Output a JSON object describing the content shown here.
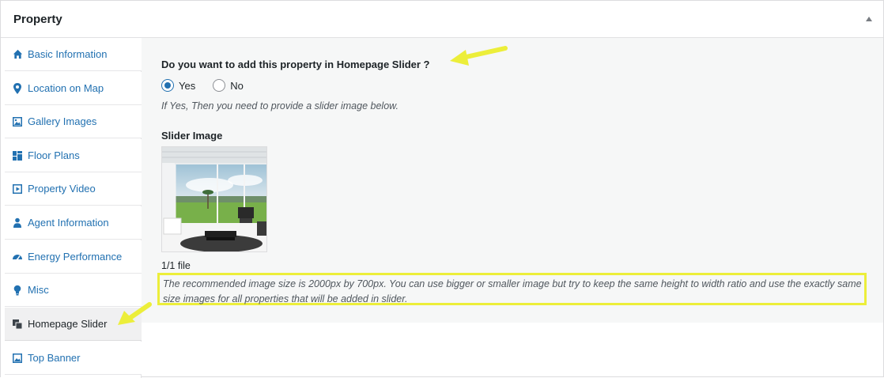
{
  "box": {
    "title": "Property",
    "toggle_icon": "triangle-up-icon"
  },
  "sidebar": {
    "items": [
      {
        "label": "Basic Information",
        "icon": "home-icon"
      },
      {
        "label": "Location on Map",
        "icon": "location-pin-icon"
      },
      {
        "label": "Gallery Images",
        "icon": "gallery-icon"
      },
      {
        "label": "Floor Plans",
        "icon": "floor-plans-icon"
      },
      {
        "label": "Property Video",
        "icon": "video-icon"
      },
      {
        "label": "Agent Information",
        "icon": "agent-icon"
      },
      {
        "label": "Energy Performance",
        "icon": "gauge-icon"
      },
      {
        "label": "Misc",
        "icon": "lightbulb-icon"
      },
      {
        "label": "Homepage Slider",
        "icon": "slides-icon",
        "active": true
      },
      {
        "label": "Top Banner",
        "icon": "banner-image-icon"
      }
    ]
  },
  "main": {
    "question": "Do you want to add this property in Homepage Slider ?",
    "options": [
      {
        "label": "Yes",
        "checked": true
      },
      {
        "label": "No",
        "checked": false
      }
    ],
    "hint": "If Yes, Then you need to provide a slider image below.",
    "slider_image_label": "Slider Image",
    "file_count": "1/1 file",
    "description": "The recommended image size is 2000px by 700px. You can use bigger or smaller image but try to keep the same height to width ratio and use the exactly same size images for all properties that will be added in slider."
  },
  "colors": {
    "link": "#2271b1",
    "highlight": "#ecee3a",
    "content_bg": "#f6f7f7"
  }
}
